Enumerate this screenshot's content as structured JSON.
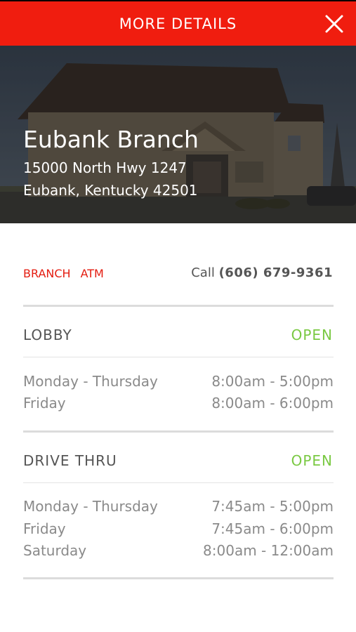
{
  "header": {
    "title": "MORE DETAILS",
    "close_icon": "close-icon"
  },
  "branch": {
    "name": "Eubank Branch",
    "address_line1": "15000 North Hwy 1247",
    "address_line2": "Eubank, Kentucky 42501"
  },
  "services": {
    "tabs": [
      {
        "label": "BRANCH"
      },
      {
        "label": "ATM"
      }
    ]
  },
  "contact": {
    "call_label": "Call",
    "phone": "(606) 679-9361"
  },
  "lobby": {
    "title": "LOBBY",
    "status": "OPEN",
    "hours": [
      {
        "day": "Monday - Thursday",
        "time": "8:00am - 5:00pm"
      },
      {
        "day": "Friday",
        "time": "8:00am - 6:00pm"
      }
    ]
  },
  "drive_thru": {
    "title": "DRIVE THRU",
    "status": "OPEN",
    "hours": [
      {
        "day": "Monday - Thursday",
        "time": "7:45am - 5:00pm"
      },
      {
        "day": "Friday",
        "time": "7:45am - 6:00pm"
      },
      {
        "day": "Saturday",
        "time": "8:00am - 12:00am"
      }
    ]
  },
  "colors": {
    "brand_red": "#f01d0f",
    "open_green": "#7ac943",
    "text_gray": "#555555"
  }
}
